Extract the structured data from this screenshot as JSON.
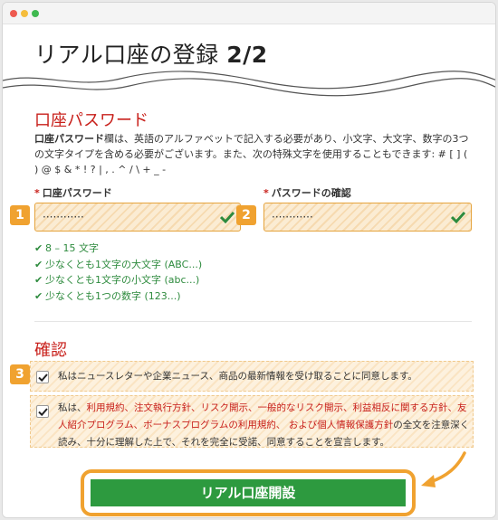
{
  "page": {
    "title": "リアル口座の登録",
    "step": "2/2"
  },
  "password_section": {
    "title": "口座パスワード",
    "desc_bold": "口座パスワード",
    "desc_rest": "欄は、英語のアルファベットで記入する必要があり、小文字、大文字、数字の3つの文字タイプを含める必要がございます。また、次の特殊文字を使用することもできます: # [ ] ( ) @ $ & * ! ? | , . ^ / \\ + _ -",
    "required_mark": "*",
    "field1": {
      "label": "口座パスワード",
      "badge": "1",
      "value": "············"
    },
    "field2": {
      "label": "パスワードの確認",
      "badge": "2",
      "value": "············"
    },
    "requirements": [
      "8 – 15 文字",
      "少なくとも1文字の大文字 (ABC...)",
      "少なくとも1文字の小文字 (abc...)",
      "少なくとも1つの数字 (123...)"
    ]
  },
  "confirm_section": {
    "title": "確認",
    "badge": "3",
    "item1": "私はニュースレターや企業ニュース、商品の最新情報を受け取ることに同意します。",
    "item2": {
      "prefix": "私は、",
      "link": "利用規約、注文執行方針、リスク開示、一般的なリスク開示、利益相反に関する方針、友人紹介プログラム、ボーナスプログラムの利用規約、 および個人情報保護方針",
      "suffix": "の全文を注意深く読み、十分に理解した上で、それを完全に受諾、同意することを宣言します。"
    }
  },
  "submit": {
    "label": "リアル口座開設"
  },
  "colors": {
    "accent_red": "#c8201b",
    "highlight_orange": "#f0a230",
    "success_green": "#2e8b3e",
    "button_green": "#2d9a3f"
  }
}
